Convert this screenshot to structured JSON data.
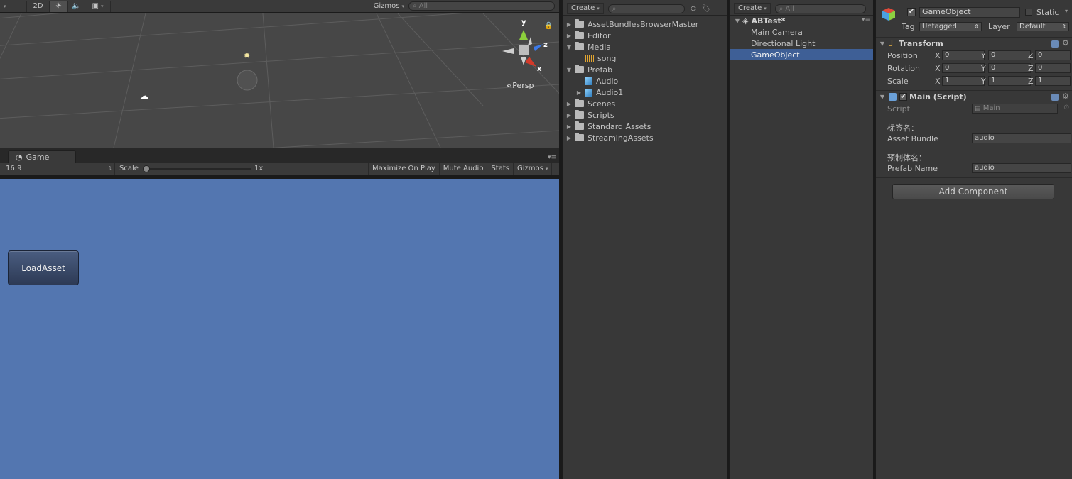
{
  "scene": {
    "toolbar": {
      "mode_2d": "2D",
      "gizmos": "Gizmos",
      "search_placeholder": "All"
    },
    "persp_label": "Persp",
    "axis_labels": {
      "y": "y",
      "z": "z",
      "x": "x"
    }
  },
  "game": {
    "tab_label": "Game",
    "aspect": "16:9",
    "scale_label": "Scale",
    "scale_value": "1x",
    "maximize_on_play": "Maximize On Play",
    "mute_audio": "Mute Audio",
    "stats": "Stats",
    "gizmos": "Gizmos",
    "load_button": "LoadAsset"
  },
  "project": {
    "create": "Create",
    "items": [
      {
        "label": "AssetBundlesBrowserMaster",
        "type": "folder",
        "depth": 0,
        "expanded": false
      },
      {
        "label": "Editor",
        "type": "folder",
        "depth": 0,
        "expanded": false
      },
      {
        "label": "Media",
        "type": "folder",
        "depth": 0,
        "expanded": true
      },
      {
        "label": "song",
        "type": "audio",
        "depth": 1,
        "expanded": null
      },
      {
        "label": "Prefab",
        "type": "folder",
        "depth": 0,
        "expanded": true
      },
      {
        "label": "Audio",
        "type": "prefab",
        "depth": 1,
        "expanded": null
      },
      {
        "label": "Audio1",
        "type": "prefab",
        "depth": 1,
        "expanded": false
      },
      {
        "label": "Scenes",
        "type": "folder",
        "depth": 0,
        "expanded": false
      },
      {
        "label": "Scripts",
        "type": "folder",
        "depth": 0,
        "expanded": false
      },
      {
        "label": "Standard Assets",
        "type": "folder",
        "depth": 0,
        "expanded": false
      },
      {
        "label": "StreamingAssets",
        "type": "folder",
        "depth": 0,
        "expanded": false
      }
    ]
  },
  "hierarchy": {
    "create": "Create",
    "search_placeholder": "All",
    "scene_name": "ABTest*",
    "items": [
      {
        "label": "Main Camera",
        "selected": false
      },
      {
        "label": "Directional Light",
        "selected": false
      },
      {
        "label": "GameObject",
        "selected": true
      }
    ]
  },
  "inspector": {
    "object_name": "GameObject",
    "static_label": "Static",
    "tag_label": "Tag",
    "tag_value": "Untagged",
    "layer_label": "Layer",
    "layer_value": "Default",
    "transform": {
      "title": "Transform",
      "rows": [
        {
          "label": "Position",
          "x": "0",
          "y": "0",
          "z": "0"
        },
        {
          "label": "Rotation",
          "x": "0",
          "y": "0",
          "z": "0"
        },
        {
          "label": "Scale",
          "x": "1",
          "y": "1",
          "z": "1"
        }
      ],
      "axis": {
        "x": "X",
        "y": "Y",
        "z": "Z"
      }
    },
    "script_component": {
      "title": "Main (Script)",
      "script_label": "Script",
      "script_value": "Main",
      "bundle_header": "标签名：",
      "bundle_label": "Asset Bundle",
      "bundle_value": "audio",
      "prefab_header": "预制体名：",
      "prefab_label": "Prefab Name",
      "prefab_value": "audio"
    },
    "add_component": "Add Component"
  },
  "colors": {
    "game_bg": "#5376b0",
    "selection": "#3e5f96",
    "panel_bg": "#383838"
  }
}
